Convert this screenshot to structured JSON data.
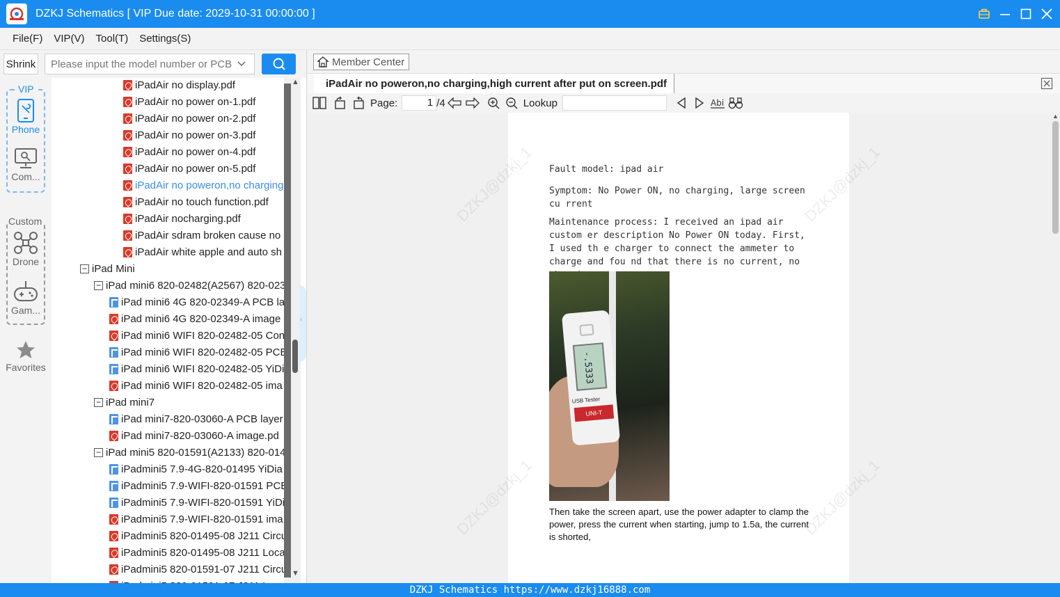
{
  "window": {
    "title": "DZKJ Schematics [ VIP Due date: 2029-10-31 00:00:00 ]",
    "accent_color": "#1a8cf0"
  },
  "menu": [
    "File(F)",
    "VIP(V)",
    "Tool(T)",
    "Settings(S)"
  ],
  "search": {
    "shrink_label": "Shrink",
    "placeholder": "Please input the model number or PCB"
  },
  "categories": {
    "vip_label": "VIP",
    "phone": "Phone",
    "computer": "Com...",
    "custom_label": "Custom",
    "drone": "Drone",
    "game": "Gam...",
    "favorites": "Favorites"
  },
  "tree": [
    {
      "label": "iPadAir no display.pdf",
      "type": "pdf",
      "indent": 2
    },
    {
      "label": "iPadAir no power on-1.pdf",
      "type": "pdf",
      "indent": 2
    },
    {
      "label": "iPadAir no power on-2.pdf",
      "type": "pdf",
      "indent": 2
    },
    {
      "label": "iPadAir no power on-3.pdf",
      "type": "pdf",
      "indent": 2
    },
    {
      "label": "iPadAir no power on-4.pdf",
      "type": "pdf",
      "indent": 2
    },
    {
      "label": "iPadAir no power on-5.pdf",
      "type": "pdf",
      "indent": 2
    },
    {
      "label": "iPadAir no poweron,no charging,high current after put on screen.pdf",
      "type": "pdf",
      "indent": 2,
      "active": true
    },
    {
      "label": "iPadAir no touch function.pdf",
      "type": "pdf",
      "indent": 2
    },
    {
      "label": "iPadAir nocharging.pdf",
      "type": "pdf",
      "indent": 2
    },
    {
      "label": "iPadAir sdram broken cause no",
      "type": "pdf",
      "indent": 2
    },
    {
      "label": "iPadAir white apple and auto sh",
      "type": "pdf",
      "indent": 2
    },
    {
      "label": "iPad Mini",
      "type": "folder",
      "indent": 0
    },
    {
      "label": "iPad mini6 820-02482(A2567) 820-023",
      "type": "folder",
      "indent": 1
    },
    {
      "label": "iPad mini6 4G 820-02349-A PCB la",
      "type": "pcb",
      "indent": 2
    },
    {
      "label": "iPad mini6 4G 820-02349-A image",
      "type": "pdf",
      "indent": 2
    },
    {
      "label": "iPad mini6 WIFI 820-02482-05 Con",
      "type": "pdf",
      "indent": 2
    },
    {
      "label": "iPad mini6 WIFI 820-02482-05 PCB",
      "type": "pcb",
      "indent": 2
    },
    {
      "label": "iPad mini6 WIFI 820-02482-05 YiDi",
      "type": "pcb",
      "indent": 2
    },
    {
      "label": "iPad mini6 WIFI 820-02482-05 ima",
      "type": "pdf",
      "indent": 2
    },
    {
      "label": "iPad mini7",
      "type": "folder",
      "indent": 1
    },
    {
      "label": "iPad mini7-820-03060-A PCB layer",
      "type": "pcb",
      "indent": 2
    },
    {
      "label": "iPad mini7-820-03060-A image.pd",
      "type": "pdf",
      "indent": 2
    },
    {
      "label": "iPad mini5 820-01591(A2133) 820-014",
      "type": "folder",
      "indent": 1
    },
    {
      "label": "iPadmini5 7.9-4G-820-01495 YiDia",
      "type": "pcb",
      "indent": 2
    },
    {
      "label": "iPadmini5 7.9-WIFI-820-01591 PCB",
      "type": "pcb",
      "indent": 2
    },
    {
      "label": "iPadmini5 7.9-WIFI-820-01591 YiDi",
      "type": "pcb",
      "indent": 2
    },
    {
      "label": "iPadmini5 7.9-WIFI-820-01591 ima",
      "type": "pdf",
      "indent": 2
    },
    {
      "label": "iPadmini5 820-01495-08 J211 Circu",
      "type": "pdf",
      "indent": 2
    },
    {
      "label": "iPadmini5 820-01495-08 J211 Loca",
      "type": "pdf",
      "indent": 2
    },
    {
      "label": "iPadmini5 820-01591-07 J211 Circu",
      "type": "pdf",
      "indent": 2
    },
    {
      "label": "iPadmini5 820-01591-07 J211 Loca",
      "type": "pdf",
      "indent": 2
    }
  ],
  "viewer": {
    "member_center": "Member Center",
    "tab_title": "iPadAir no poweron,no charging,high current after put on screen.pdf",
    "page_label": "Page:",
    "page_current": "1",
    "page_total": "/4",
    "lookup_label": "Lookup",
    "lookup_value": ""
  },
  "document": {
    "fault_model": "Fault model: ipad air",
    "symptom": "Symptom: No Power ON, no charging, large screen cu rrent",
    "process": "Maintenance process: I received an ipad air custom er description No Power ON today. First, I used th e charger to connect the ammeter to charge and fou nd that there is no current, no charging.",
    "photo_text": {
      "tester": "USB Tester",
      "brand": "UNI-T",
      "lcd": "-.5333"
    },
    "after_photo": "Then take the screen apart, use the power adapter to clamp the power, press the current when starting, jump to 1.5a, the current is shorted,",
    "watermark": "DZKJ@dzkj_1"
  },
  "status": "DZKJ Schematics https://www.dzkj16888.com"
}
